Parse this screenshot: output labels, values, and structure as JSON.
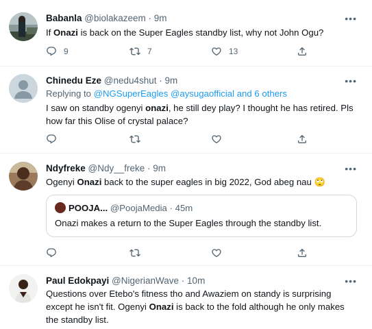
{
  "tweets": [
    {
      "name": "Babanla",
      "handle": "@biolakazeem",
      "time": "9m",
      "text_pre": "If ",
      "text_bold": "Onazi",
      "text_post": " is back on the Super Eagles standby list, why not John Ogu?",
      "replies": "9",
      "retweets": "7",
      "likes": "13"
    },
    {
      "name": "Chinedu Eze",
      "handle": "@nedu4shut",
      "time": "9m",
      "reply_prefix": "Replying to ",
      "reply_targets": "@NGSuperEagles @aysugaofficial and 6 others",
      "text_pre": "I saw on standby ogenyi ",
      "text_bold": "onazi",
      "text_post": ", he still dey play? I thought he has retired. Pls how far this Olise of crystal palace?"
    },
    {
      "name": "Ndyfreke",
      "handle": "@Ndy__freke",
      "time": "9m",
      "text_pre": "Ogenyi ",
      "text_bold": "Onazi",
      "text_post": " back to the super eagles in big 2022, God abeg nau",
      "emoji": "🙄",
      "quote": {
        "name": "POOJA...",
        "handle": "@PoojaMedia",
        "time": "45m",
        "text": "Onazi makes a return to the Super Eagles through the standby list."
      }
    },
    {
      "name": "Paul Edokpayi",
      "handle": "@NigerianWave",
      "time": "10m",
      "text_pre": "Questions over Etebo's fitness tho and Awaziem on standy is surprising except he isn't fit. Ogenyi ",
      "text_bold": "Onazi",
      "text_post": " is back to the fold although he only makes the standby list."
    }
  ],
  "ui": {
    "separator": " · ",
    "more_glyph": "•••",
    "icons": [
      "reply-icon",
      "retweet-icon",
      "like-icon",
      "share-icon",
      "more-icon"
    ],
    "colors": {
      "link": "#1d9bf0",
      "meta": "#536471",
      "border": "#eff3f4"
    }
  }
}
